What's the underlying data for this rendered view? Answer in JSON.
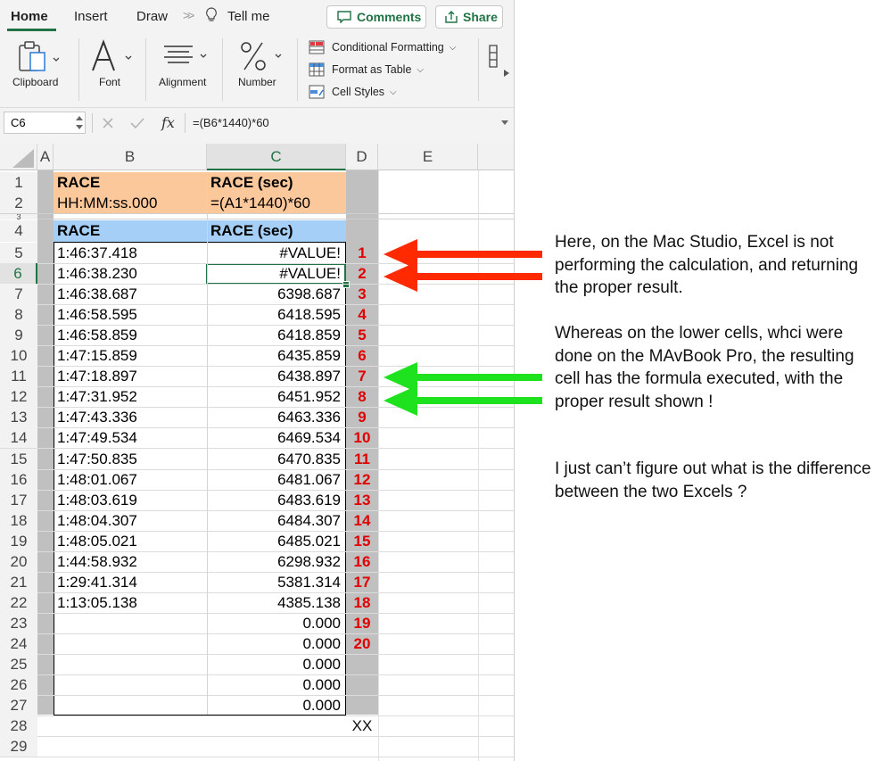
{
  "ribbon": {
    "tabs": [
      "Home",
      "Insert",
      "Draw",
      "Tell me"
    ],
    "comments_label": "Comments",
    "share_label": "Share",
    "groups": {
      "clipboard": "Clipboard",
      "font": "Font",
      "alignment": "Alignment",
      "number": "Number"
    },
    "styles": {
      "conditional_formatting": "Conditional Formatting",
      "format_as_table": "Format as Table",
      "cell_styles": "Cell Styles"
    }
  },
  "formula_bar": {
    "name_box": "C6",
    "fx": "fx",
    "formula": "=(B6*1440)*60"
  },
  "sheet": {
    "columns": [
      "A",
      "B",
      "C",
      "D",
      "E"
    ],
    "header1": {
      "b": "RACE",
      "c": "RACE (sec)"
    },
    "header2": {
      "b": "HH:MM:ss.000",
      "c": "=(A1*1440)*60"
    },
    "header4": {
      "b": "RACE",
      "c": "RACE (sec)"
    },
    "rows": [
      {
        "n": "5",
        "b": "1:46:37.418",
        "c": "#VALUE!",
        "d": "1"
      },
      {
        "n": "6",
        "b": "1:46:38.230",
        "c": "#VALUE!",
        "d": "2"
      },
      {
        "n": "7",
        "b": "1:46:38.687",
        "c": "6398.687",
        "d": "3"
      },
      {
        "n": "8",
        "b": "1:46:58.595",
        "c": "6418.595",
        "d": "4"
      },
      {
        "n": "9",
        "b": "1:46:58.859",
        "c": "6418.859",
        "d": "5"
      },
      {
        "n": "10",
        "b": "1:47:15.859",
        "c": "6435.859",
        "d": "6"
      },
      {
        "n": "11",
        "b": "1:47:18.897",
        "c": "6438.897",
        "d": "7"
      },
      {
        "n": "12",
        "b": "1:47:31.952",
        "c": "6451.952",
        "d": "8"
      },
      {
        "n": "13",
        "b": "1:47:43.336",
        "c": "6463.336",
        "d": "9"
      },
      {
        "n": "14",
        "b": "1:47:49.534",
        "c": "6469.534",
        "d": "10"
      },
      {
        "n": "15",
        "b": "1:47:50.835",
        "c": "6470.835",
        "d": "11"
      },
      {
        "n": "16",
        "b": "1:48:01.067",
        "c": "6481.067",
        "d": "12"
      },
      {
        "n": "17",
        "b": "1:48:03.619",
        "c": "6483.619",
        "d": "13"
      },
      {
        "n": "18",
        "b": "1:48:04.307",
        "c": "6484.307",
        "d": "14"
      },
      {
        "n": "19",
        "b": "1:48:05.021",
        "c": "6485.021",
        "d": "15"
      },
      {
        "n": "20",
        "b": "1:44:58.932",
        "c": "6298.932",
        "d": "16"
      },
      {
        "n": "21",
        "b": "1:29:41.314",
        "c": "5381.314",
        "d": "17"
      },
      {
        "n": "22",
        "b": "1:13:05.138",
        "c": "4385.138",
        "d": "18"
      },
      {
        "n": "23",
        "b": "",
        "c": "0.000",
        "d": "19"
      },
      {
        "n": "24",
        "b": "",
        "c": "0.000",
        "d": "20"
      },
      {
        "n": "25",
        "b": "",
        "c": "0.000",
        "d": ""
      },
      {
        "n": "26",
        "b": "",
        "c": "0.000",
        "d": ""
      },
      {
        "n": "27",
        "b": "",
        "c": "0.000",
        "d": ""
      },
      {
        "n": "28",
        "b": "",
        "c": "",
        "d": "XX"
      },
      {
        "n": "29",
        "b": "",
        "c": "",
        "d": ""
      }
    ],
    "row_numbers_top": [
      "1",
      "2",
      "3",
      "4"
    ]
  },
  "colors": {
    "excel_green": "#217346",
    "header_orange": "#fbc89b",
    "header_blue": "#a6cff7",
    "gray_col": "#c0c0c0",
    "red_arrow": "#ff2a00",
    "green_arrow": "#1de21d",
    "index_red": "#e00000"
  },
  "notes": {
    "p1": "Here, on the Mac Studio, Excel is not performing the calculation, and returning the proper result.",
    "p2": "Whereas on the lower cells, whci were done on the MAvBook Pro, the resulting cell has the formula executed, with the proper result shown !",
    "p3": "I just can’t figure out what is the difference between the two Excels ?"
  }
}
